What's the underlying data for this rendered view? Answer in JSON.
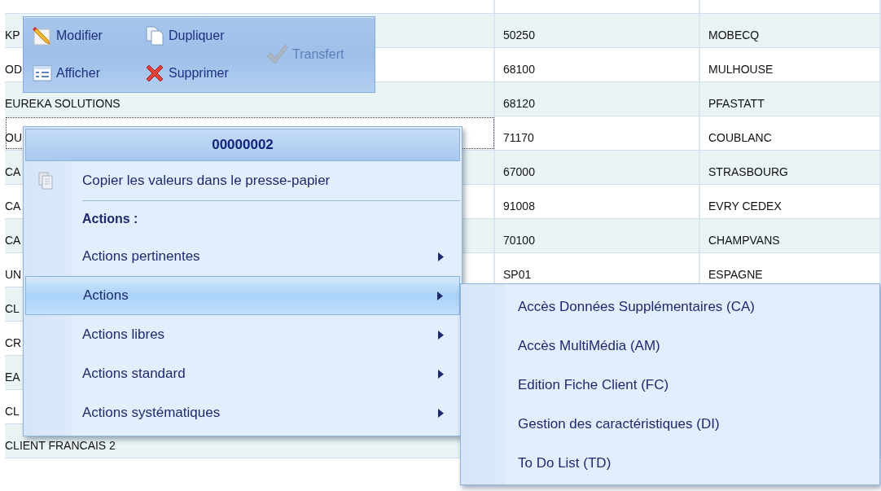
{
  "grid": {
    "rows": [
      {
        "cells": [
          "KP",
          "50250",
          "MOBECQ"
        ],
        "focused": false
      },
      {
        "cells": [
          "OD",
          "68100",
          "MULHOUSE"
        ],
        "focused": false
      },
      {
        "cells": [
          "EUREKA SOLUTIONS",
          "68120",
          "PFASTATT"
        ],
        "focused": false
      },
      {
        "cells": [
          "OU",
          "71170",
          "COUBLANC"
        ],
        "focused": true
      },
      {
        "cells": [
          "CA",
          "67000",
          "STRASBOURG"
        ],
        "focused": false
      },
      {
        "cells": [
          "CA",
          "91008",
          "EVRY CEDEX"
        ],
        "focused": false
      },
      {
        "cells": [
          "CA",
          "70100",
          "CHAMPVANS"
        ],
        "focused": false
      },
      {
        "cells": [
          "UN",
          "SP01",
          "ESPAGNE"
        ],
        "focused": false
      },
      {
        "cells": [
          "CL"
        ],
        "focused": false
      },
      {
        "cells": [
          "CR"
        ],
        "focused": false
      },
      {
        "cells": [
          "EA"
        ],
        "focused": false
      },
      {
        "cells": [
          "CL"
        ],
        "focused": false
      },
      {
        "cells": [
          "CLIENT FRANCAIS 2"
        ],
        "focused": false
      }
    ]
  },
  "toolbar": {
    "items": [
      {
        "label": "Modifier",
        "disabled": false
      },
      {
        "label": "Dupliquer",
        "disabled": false
      },
      {
        "label": "Afficher",
        "disabled": false
      },
      {
        "label": "Supprimer",
        "disabled": false
      },
      {
        "label": "Transfert",
        "disabled": true
      }
    ]
  },
  "context_menu": {
    "title": "00000002",
    "items": [
      {
        "kind": "command",
        "label": "Copier les valeurs dans le presse-papier",
        "submenu": false,
        "selected": false
      },
      {
        "kind": "separator"
      },
      {
        "kind": "header",
        "label": "Actions :"
      },
      {
        "kind": "command",
        "label": "Actions pertinentes",
        "submenu": true,
        "selected": false
      },
      {
        "kind": "command",
        "label": "Actions",
        "submenu": true,
        "selected": true
      },
      {
        "kind": "command",
        "label": "Actions libres",
        "submenu": true,
        "selected": false
      },
      {
        "kind": "command",
        "label": "Actions standard",
        "submenu": true,
        "selected": false
      },
      {
        "kind": "command",
        "label": "Actions systématiques",
        "submenu": true,
        "selected": false
      }
    ]
  },
  "submenu": {
    "items": [
      {
        "label": "Accès Données Supplémentaires (CA)"
      },
      {
        "label": "Accès MultiMédia (AM)"
      },
      {
        "label": "Edition Fiche Client (FC)"
      },
      {
        "label": "Gestion des caractéristiques (DI)"
      },
      {
        "label": "To Do List (TD)"
      }
    ]
  }
}
